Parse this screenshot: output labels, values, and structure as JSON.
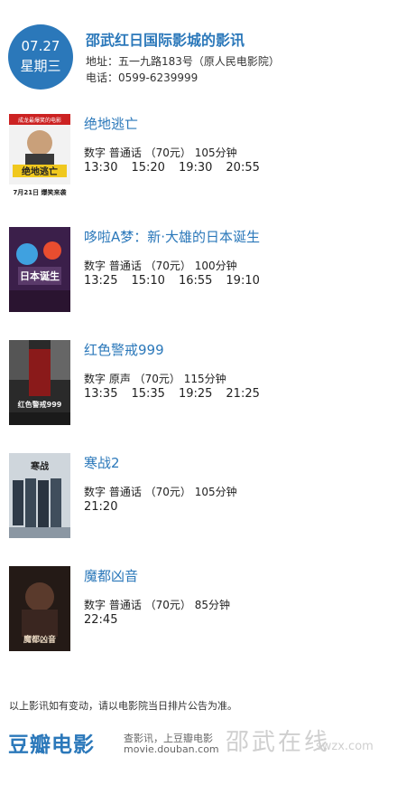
{
  "header": {
    "date": "07.27",
    "weekday": "星期三",
    "cinema_name": "邵武红日国际影城的影讯",
    "address": "地址：五一九路183号（原人民电影院）",
    "phone": "电话：0599-6239999"
  },
  "movies": [
    {
      "title": "绝地逃亡",
      "meta": "数字  普通话 （70元） 105分钟",
      "times": [
        "13:30",
        "15:20",
        "19:30",
        "20:55"
      ],
      "poster_texts": [
        "成龙最爆笑的电影",
        "绝地逃亡",
        "7月21日 爆笑来袭"
      ]
    },
    {
      "title": "哆啦A梦：新·大雄的日本诞生",
      "meta": "数字  普通话 （70元） 100分钟",
      "times": [
        "13:25",
        "15:10",
        "16:55",
        "19:10"
      ],
      "poster_texts": [
        "日本诞生"
      ]
    },
    {
      "title": "红色警戒999",
      "meta": "数字  原声 （70元） 115分钟",
      "times": [
        "13:35",
        "15:35",
        "19:25",
        "21:25"
      ],
      "poster_texts": [
        "红色警戒999"
      ]
    },
    {
      "title": "寒战2",
      "meta": "数字  普通话 （70元） 105分钟",
      "times": [
        "21:20"
      ],
      "poster_texts": [
        "寒战"
      ]
    },
    {
      "title": "魔都凶音",
      "meta": "数字  普通话 （70元） 85分钟",
      "times": [
        "22:45"
      ],
      "poster_texts": [
        "魔都凶音"
      ]
    }
  ],
  "footer": {
    "notice": "以上影讯如有变动，请以电影院当日排片公告为准。",
    "logo": "豆瓣电影",
    "tagline": "查影讯，上豆瓣电影",
    "url": "movie.douban.com",
    "watermark": "邵武在线",
    "watermark_url": "swzx.com"
  },
  "colors": {
    "accent": "#2b78ba",
    "text": "#222222",
    "muted": "#666666"
  }
}
